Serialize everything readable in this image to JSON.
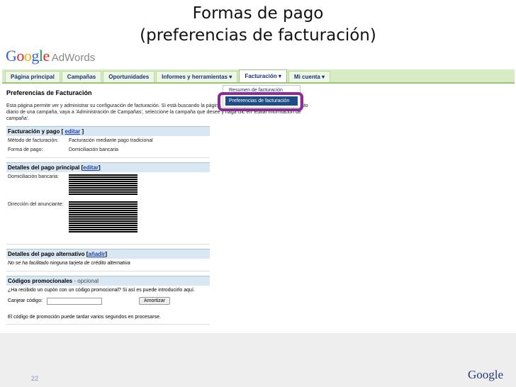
{
  "slide": {
    "title_line1": "Formas de pago",
    "title_line2": "(preferencias de facturación)",
    "page_number": "22",
    "footer_brand": "Google"
  },
  "logo": {
    "g1": "G",
    "o1": "o",
    "o2": "o",
    "g2": "g",
    "l": "l",
    "e": "e",
    "product": "AdWords"
  },
  "nav": {
    "tabs": [
      "Página principal",
      "Campañas",
      "Oportunidades",
      "Informes y herramientas ▾",
      "Facturación ▾",
      "Mi cuenta ▾"
    ]
  },
  "dropdown": {
    "items": [
      "Resumen de facturación",
      "Preferencias de facturación"
    ]
  },
  "page": {
    "heading": "Preferencias de Facturación",
    "intro": "Esta página permite ver y administrar su configuración de facturación. Si está buscando la página en la que puede revisar el presupuesto diario de una campaña, vaya a 'Administración de Campañas', seleccione la campaña que desee y haga clic en 'Editar información de campaña'."
  },
  "billing": {
    "header": "Facturación y pago",
    "edit_link": "editar",
    "rows": [
      {
        "label": "Método de facturación:",
        "value": "Facturación mediante pago tradicional"
      },
      {
        "label": "Forma de pago:",
        "value": "Domiciliación bancaria"
      }
    ]
  },
  "primary": {
    "header": "Detalles del pago principal",
    "edit_link": "editar",
    "bank_label": "Domiciliación bancaria:",
    "address_label": "Dirección del anunciante:"
  },
  "alternative": {
    "header": "Detalles del pago alternativo",
    "add_link": "añadir",
    "note": "No se ha facilitado ninguna tarjeta de crédito alternativa"
  },
  "promo": {
    "header": "Códigos promocionales",
    "optional": "- opcional",
    "question": "¿Ha recibido un cupón con un código promocional? Si así es puede introducirlo aquí.",
    "redeem_label": "Canjear código:",
    "input_value": "",
    "button": "Amortizar",
    "note": "El código de promoción puede tardar varios segundos en procesarse."
  }
}
